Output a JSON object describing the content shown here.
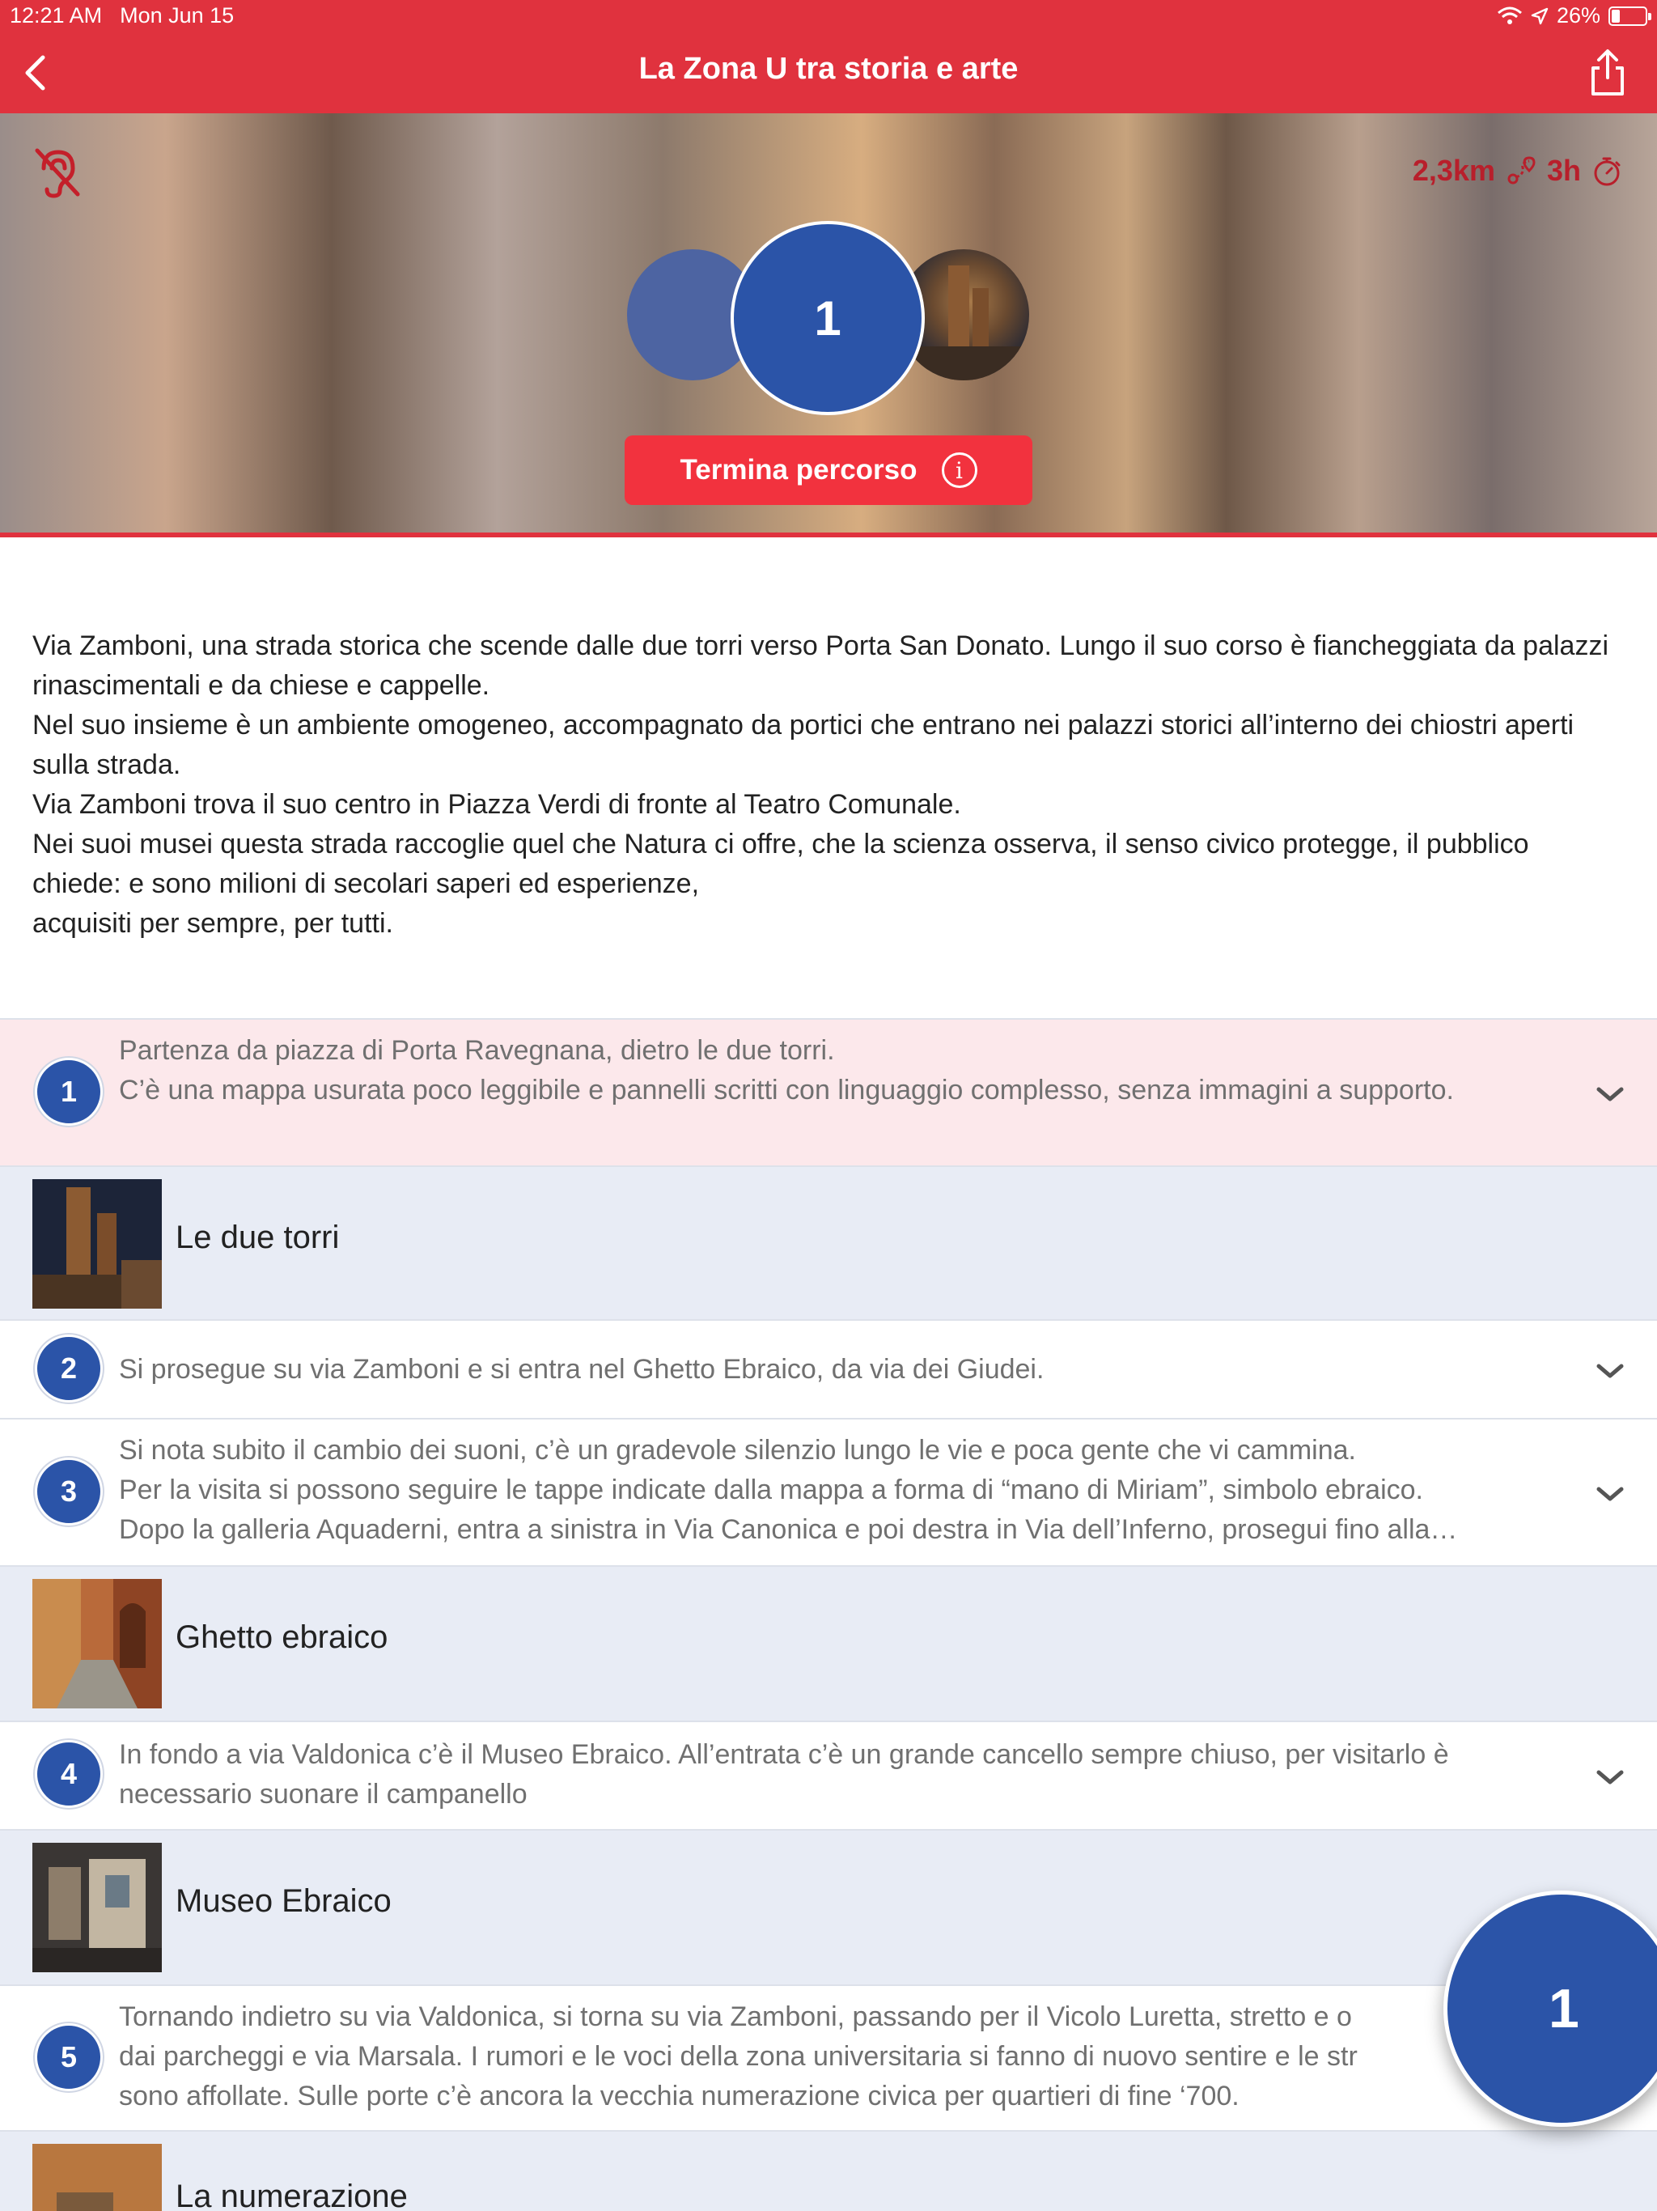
{
  "status_bar": {
    "time": "12:21 AM",
    "date": "Mon Jun 15",
    "battery": "26%",
    "battery_level": 0.26
  },
  "nav": {
    "title": "La Zona U tra storia e arte",
    "back_icon": "chevron-left-icon",
    "share_icon": "share-icon"
  },
  "hero": {
    "distance": "2,3km",
    "duration": "3h",
    "current_step": "1",
    "end_button_label": "Termina percorso",
    "info_symbol": "i"
  },
  "description": [
    "Via Zamboni, una strada storica che scende dalle due torri verso Porta San Donato. Lungo il suo corso è fiancheggiata da palazzi rinascimentali e da chiese e cappelle.",
    "Nel suo insieme è un ambiente omogeneo, accompagnato da portici che entrano nei palazzi storici all’interno dei chiostri aperti sulla strada.",
    "Via Zamboni trova il suo centro in Piazza Verdi di fronte al Teatro Comunale.",
    "Nei suoi musei questa strada raccoglie quel che Natura ci offre, che la scienza osserva, il senso civico protegge, il pubblico chiede: e sono milioni di secolari saperi ed esperienze,",
    "acquisiti per sempre, per tutti."
  ],
  "steps": [
    {
      "number": "1",
      "text": "Partenza da piazza di Porta Ravegnana, dietro le due torri.\nC’è una mappa usurata poco leggibile e pannelli scritti con linguaggio complesso, senza immagini a supporto."
    },
    {
      "poi": "Le due torri"
    },
    {
      "number": "2",
      "text": "Si prosegue su via Zamboni e si entra nel Ghetto Ebraico, da via dei Giudei."
    },
    {
      "number": "3",
      "lines": [
        "Si nota subito il cambio dei suoni, c’è un gradevole silenzio lungo le vie e poca gente che vi cammina.",
        "Per la visita si possono seguire le tappe indicate dalla mappa a forma di “mano di Miriam”, simbolo ebraico.",
        "Dopo la galleria Aquaderni, entra a sinistra in Via Canonica e poi destra in Via dell’Inferno, prosegui fino alla…"
      ]
    },
    {
      "poi": "Ghetto ebraico"
    },
    {
      "number": "4",
      "text": "In fondo a via Valdonica c’è il Museo Ebraico. All’entrata c’è un grande cancello sempre chiuso, per visitarlo è necessario suonare il campanello"
    },
    {
      "poi": "Museo Ebraico"
    },
    {
      "number": "5",
      "lines": [
        "Tornando indietro su via Valdonica, si torna su via Zamboni, passando per il Vicolo Luretta, stretto e o",
        "dai parcheggi e via Marsala. I rumori e le voci della zona universitaria si fanno di nuovo sentire e le str",
        "sono affollate. Sulle porte c’è ancora la vecchia numerazione civica per quartieri di fine ‘700."
      ]
    },
    {
      "poi": "La numerazione"
    }
  ],
  "fab": {
    "label": "1"
  },
  "colors": {
    "brand_red": "#e0323e",
    "step_blue": "#2b54a8",
    "highlight_row": "#fce8eb",
    "poi_row": "#e8ecf5"
  }
}
